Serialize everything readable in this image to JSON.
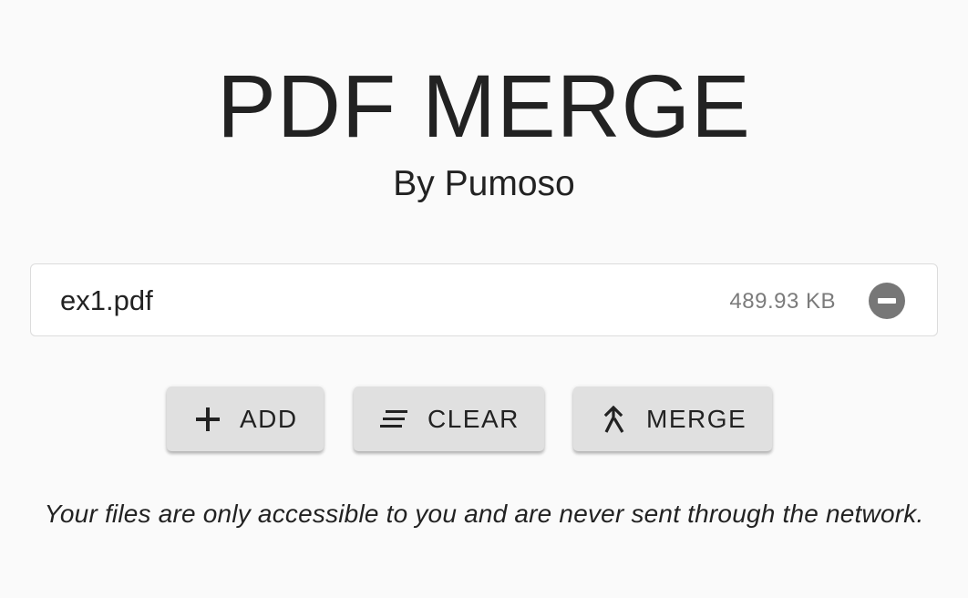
{
  "header": {
    "title": "PDF MERGE",
    "subtitle": "By Pumoso"
  },
  "files": [
    {
      "name": "ex1.pdf",
      "size": "489.93 KB",
      "remove_icon": "remove-circle-icon"
    }
  ],
  "actions": {
    "add": {
      "label": "ADD",
      "icon": "plus-icon"
    },
    "clear": {
      "label": "CLEAR",
      "icon": "clear-all-icon"
    },
    "merge": {
      "label": "MERGE",
      "icon": "merge-icon"
    }
  },
  "footer_note": "Your files are only accessible to you and are never sent through the network.",
  "colors": {
    "background": "#fafafa",
    "button": "#e0e0e0",
    "remove_icon": "#777777",
    "muted_text": "#7b7b7b"
  }
}
